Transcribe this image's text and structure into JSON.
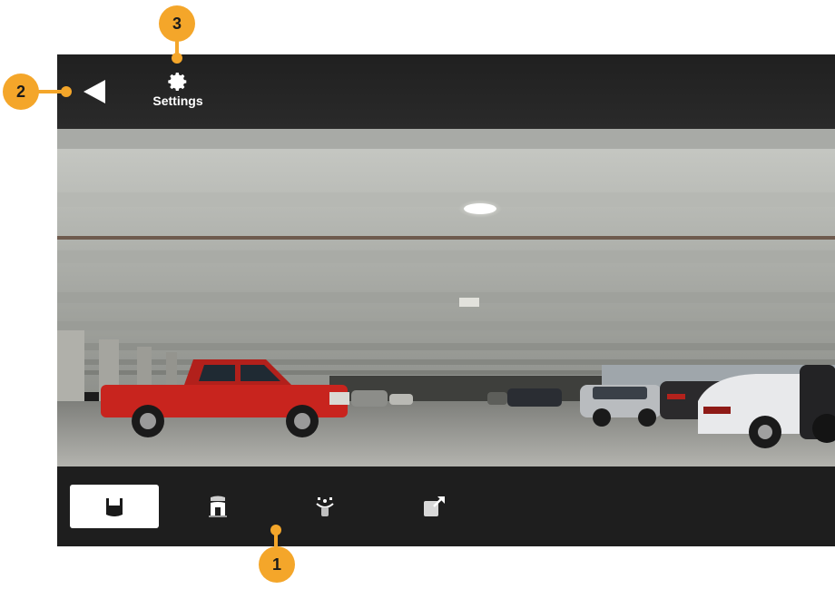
{
  "topbar": {
    "settings_label": "Settings",
    "back_icon": "back-triangle-icon",
    "settings_icon": "gear-icon"
  },
  "camera_view": {
    "description_icon": "parking-garage-camera-feed"
  },
  "bottombar": {
    "modes": [
      {
        "icon": "front-view-icon",
        "selected": true
      },
      {
        "icon": "top-view-icon",
        "selected": false
      },
      {
        "icon": "hitch-view-icon",
        "selected": false
      },
      {
        "icon": "external-window-icon",
        "selected": false
      }
    ]
  },
  "callouts": [
    {
      "number": "1"
    },
    {
      "number": "2"
    },
    {
      "number": "3"
    }
  ],
  "colors": {
    "callout": "#f4a62a",
    "active_mode_bg": "#ffffff",
    "bar_bg": "#1e1e1e"
  }
}
